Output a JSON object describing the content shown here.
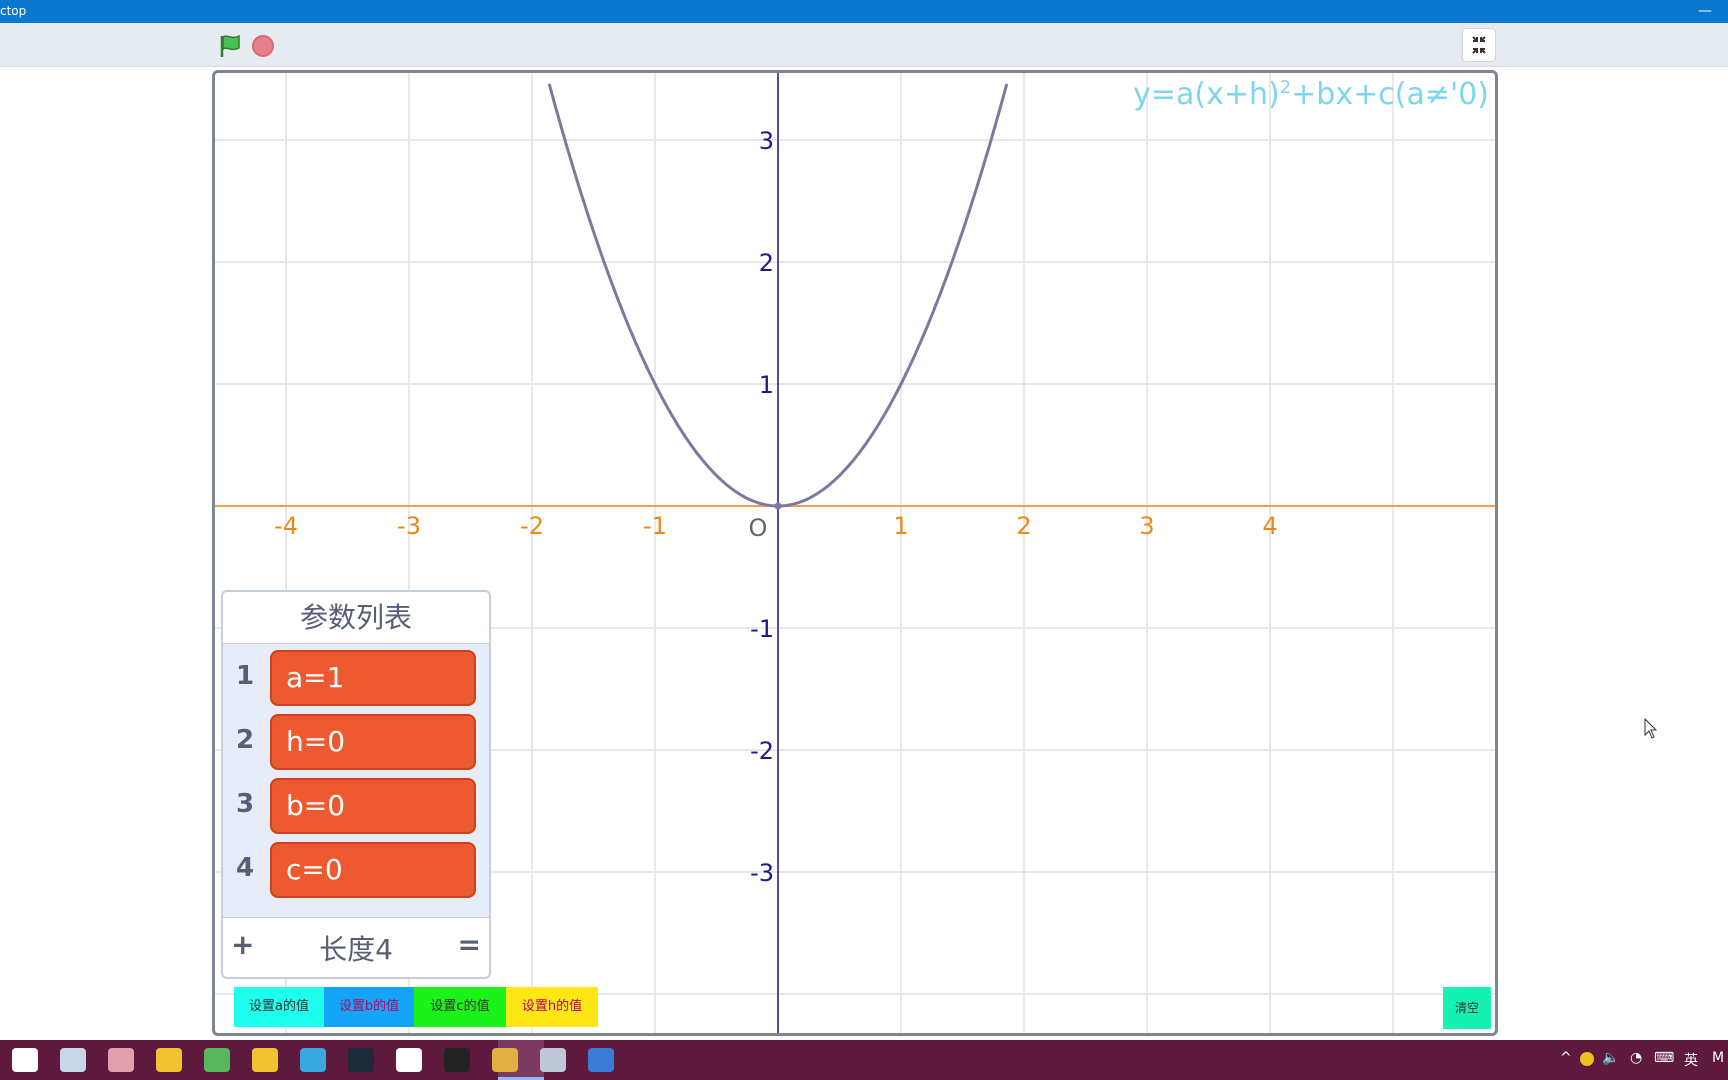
{
  "window": {
    "title": "ctop",
    "minimize_icon": "minimize-icon"
  },
  "toolbar": {
    "flag_icon": "green-flag-icon",
    "stop_icon": "stop-icon",
    "fullscreen_icon": "exit-fullscreen-icon"
  },
  "stage": {
    "formula": "y=a(x+h)",
    "formula_sup": "2",
    "formula_tail": "+bx+c(a≠'0)",
    "origin_label": "O",
    "x_ticks": [
      "-4",
      "-3",
      "-2",
      "-1",
      "1",
      "2",
      "3",
      "4"
    ],
    "y_ticks": [
      "3",
      "2",
      "1",
      "-1",
      "-2",
      "-3"
    ],
    "colors": {
      "x_axis": "#f0a050",
      "x_labels": "#e88a1a",
      "y_axis": "#1a1a8a",
      "y_labels": "#1a1a8a",
      "curve": "#7a7aa0",
      "grid": "#e8e8ec",
      "formula": "#7cd6ec"
    }
  },
  "list": {
    "title": "参数列表",
    "items": [
      {
        "index": "1",
        "value": "a=1"
      },
      {
        "index": "2",
        "value": "h=0"
      },
      {
        "index": "3",
        "value": "b=0"
      },
      {
        "index": "4",
        "value": "c=0"
      }
    ],
    "add_label": "+",
    "length_label": "长度4",
    "resize_label": "="
  },
  "buttons": {
    "set_a": "设置a的值",
    "set_b": "设置b的值",
    "set_c": "设置c的值",
    "set_h": "设置h的值",
    "clear": "清空"
  },
  "chart_data": {
    "type": "line",
    "title": "y=a(x+h)²+bx+c(a≠0)",
    "series": [
      {
        "values": [
          [
            -1.85,
            3.42
          ],
          [
            -1.5,
            2.25
          ],
          [
            -1.0,
            1.0
          ],
          [
            -0.5,
            0.25
          ],
          [
            0,
            0
          ],
          [
            0.5,
            0.25
          ],
          [
            1.0,
            1.0
          ],
          [
            1.5,
            2.25
          ],
          [
            1.85,
            3.42
          ]
        ]
      }
    ],
    "xlim": [
      -4.7,
      4.7
    ],
    "ylim": [
      -3.5,
      3.5
    ],
    "x_ticks": [
      -4,
      -3,
      -2,
      -1,
      1,
      2,
      3,
      4
    ],
    "y_ticks": [
      -3,
      -2,
      -1,
      1,
      2,
      3
    ],
    "grid": true
  },
  "taskbar": {
    "icons": [
      "s-logo-icon",
      "file-icon",
      "paint-icon",
      "chrome-icon",
      "browser-icon",
      "folder-icon",
      "triangle-app-icon",
      "cs-app-icon",
      "capcut-icon",
      "ok-app-icon",
      "notes-app-icon",
      "paint-app-icon",
      "window-app-icon"
    ],
    "tray": {
      "ime": "英",
      "letter": "M"
    }
  }
}
